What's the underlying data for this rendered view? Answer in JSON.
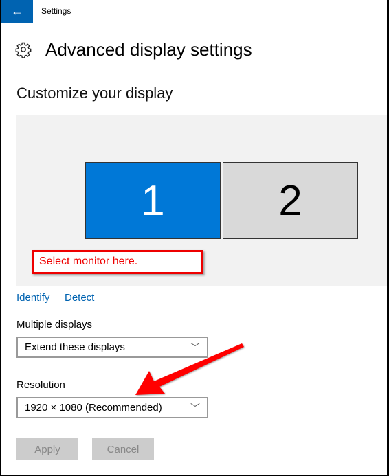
{
  "titlebar": {
    "back_icon": "arrow-left",
    "app_title": "Settings"
  },
  "header": {
    "icon": "gear-icon",
    "title": "Advanced display settings"
  },
  "section_title": "Customize your display",
  "monitors": [
    {
      "label": "1",
      "selected": true,
      "color": "#0078d7"
    },
    {
      "label": "2",
      "selected": false,
      "color": "#d9d9d9"
    }
  ],
  "annotation": {
    "callout": "Select monitor here.",
    "color": "#ff0000"
  },
  "links": {
    "identify": "Identify",
    "detect": "Detect"
  },
  "multiple_displays": {
    "label": "Multiple displays",
    "value": "Extend these displays"
  },
  "resolution": {
    "label": "Resolution",
    "value": "1920 × 1080 (Recommended)"
  },
  "buttons": {
    "apply": "Apply",
    "cancel": "Cancel"
  }
}
